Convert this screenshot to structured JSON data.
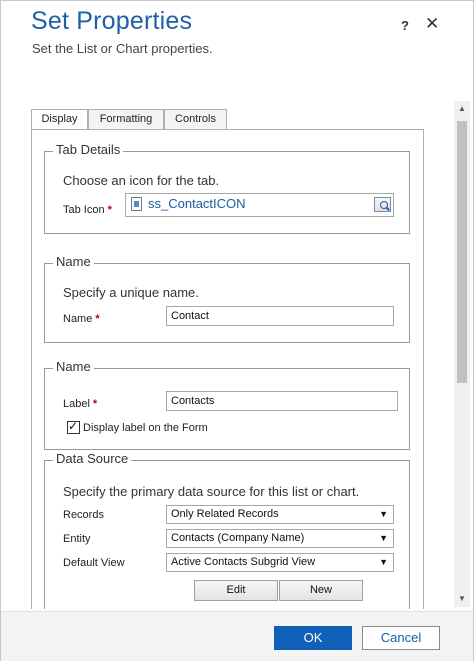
{
  "dialog": {
    "title": "Set Properties",
    "subtitle": "Set the List or Chart properties.",
    "help_label": "?",
    "close_label": "✕"
  },
  "tabs": [
    "Display",
    "Formatting",
    "Controls"
  ],
  "tab_details": {
    "legend": "Tab Details",
    "description": "Choose an icon for the tab.",
    "icon_label": "Tab Icon",
    "required_mark": "*",
    "icon_value": "ss_ContactICON"
  },
  "name_section": {
    "legend": "Name",
    "description": "Specify a unique name.",
    "name_label": "Name",
    "required_mark": "*",
    "name_value": "Contact"
  },
  "label_section": {
    "legend": "Name",
    "label_label": "Label",
    "required_mark": "*",
    "label_value": "Contacts",
    "display_label_checked": true,
    "display_label_text": "Display label on the Form"
  },
  "data_source": {
    "legend": "Data Source",
    "description": "Specify the primary data source for this list or chart.",
    "records_label": "Records",
    "records_value": "Only Related Records",
    "entity_label": "Entity",
    "entity_value": "Contacts (Company Name)",
    "default_view_label": "Default View",
    "default_view_value": "Active Contacts Subgrid View",
    "edit_label": "Edit",
    "new_label": "New"
  },
  "footer": {
    "ok_label": "OK",
    "cancel_label": "Cancel"
  },
  "icons": {
    "dropdown_arrow": "▼",
    "scroll_up": "▲",
    "scroll_down": "▼",
    "checkmark": "✓"
  },
  "colors": {
    "title": "#1f5fa8",
    "ok_button": "#1160b7",
    "required": "#c00000"
  }
}
